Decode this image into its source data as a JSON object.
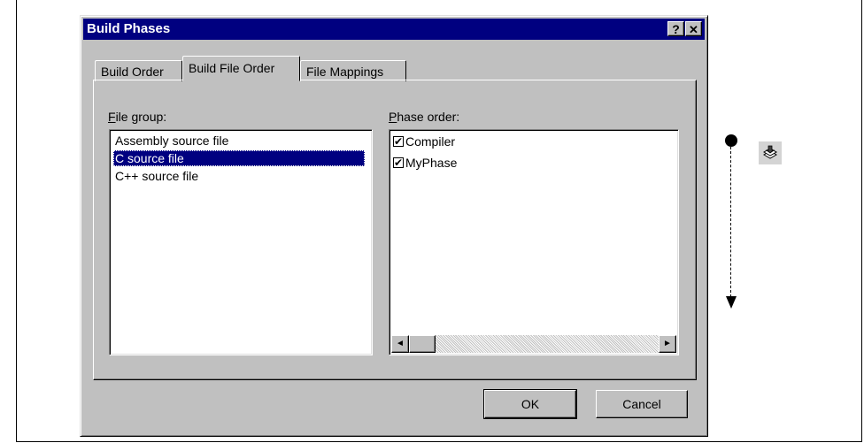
{
  "dialog": {
    "title": "Build Phases",
    "help_label": "?",
    "close_label": "✕"
  },
  "tabs": [
    {
      "label": "Build Order",
      "active": false
    },
    {
      "label": "Build File Order",
      "active": true
    },
    {
      "label": "File Mappings",
      "active": false
    }
  ],
  "file_group": {
    "label_accel": "F",
    "label_rest": "ile group:",
    "items": [
      "Assembly source file",
      "C source file",
      "C++ source file"
    ],
    "selected": "C source file"
  },
  "phase_order": {
    "label_accel": "P",
    "label_rest": "hase order:",
    "items": [
      {
        "label": "Compiler",
        "checked": true
      },
      {
        "label": "MyPhase",
        "checked": true
      }
    ],
    "scroll_left": "◄",
    "scroll_right": "►"
  },
  "buttons": {
    "ok": "OK",
    "cancel": "Cancel"
  },
  "icons": {
    "checkmark": "✔",
    "side_icon": "stacked-layers-icon"
  }
}
